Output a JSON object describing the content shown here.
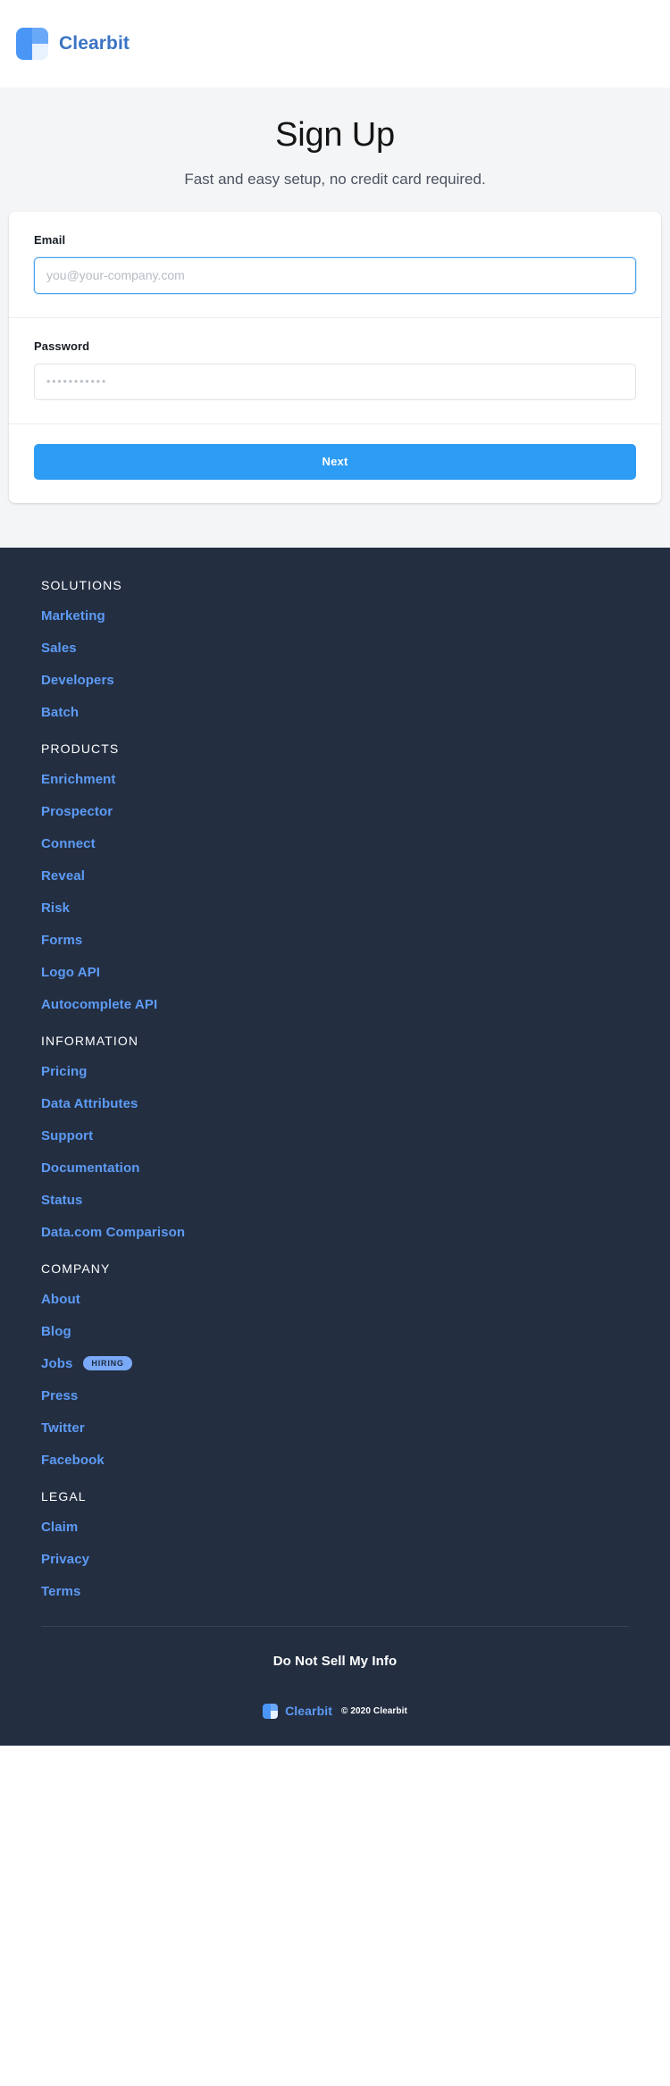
{
  "header": {
    "logo_icon": "clearbit-logo-icon",
    "brand_name": "Clearbit"
  },
  "hero": {
    "title": "Sign Up",
    "subtitle": "Fast and easy setup, no credit card required."
  },
  "form": {
    "email": {
      "label": "Email",
      "value": "",
      "placeholder": "you@your-company.com",
      "focused": true
    },
    "password": {
      "label": "Password",
      "value": "",
      "placeholder": "•••••••••••",
      "focused": false
    },
    "submit_label": "Next"
  },
  "footer": {
    "groups": [
      {
        "heading": "SOLUTIONS",
        "links": [
          {
            "label": "Marketing"
          },
          {
            "label": "Sales"
          },
          {
            "label": "Developers"
          },
          {
            "label": "Batch"
          }
        ]
      },
      {
        "heading": "PRODUCTS",
        "links": [
          {
            "label": "Enrichment"
          },
          {
            "label": "Prospector"
          },
          {
            "label": "Connect"
          },
          {
            "label": "Reveal"
          },
          {
            "label": "Risk"
          },
          {
            "label": "Forms"
          },
          {
            "label": "Logo API"
          },
          {
            "label": "Autocomplete API"
          }
        ]
      },
      {
        "heading": "INFORMATION",
        "links": [
          {
            "label": "Pricing"
          },
          {
            "label": "Data Attributes"
          },
          {
            "label": "Support"
          },
          {
            "label": "Documentation"
          },
          {
            "label": "Status"
          },
          {
            "label": "Data.com Comparison"
          }
        ]
      },
      {
        "heading": "COMPANY",
        "links": [
          {
            "label": "About"
          },
          {
            "label": "Blog"
          },
          {
            "label": "Jobs",
            "badge": "HIRING"
          },
          {
            "label": "Press"
          },
          {
            "label": "Twitter"
          },
          {
            "label": "Facebook"
          }
        ]
      },
      {
        "heading": "LEGAL",
        "links": [
          {
            "label": "Claim"
          },
          {
            "label": "Privacy"
          },
          {
            "label": "Terms"
          }
        ]
      }
    ],
    "do_not_sell": "Do Not Sell My Info",
    "brand_name": "Clearbit",
    "copyright": "© 2020 Clearbit",
    "logo_icon": "clearbit-logo-icon"
  },
  "colors": {
    "brand_blue": "#3b74c4",
    "link_blue": "#5d9bf5",
    "button_blue": "#2d9cf5",
    "footer_bg": "#232e41",
    "hero_bg": "#f4f5f7",
    "badge_bg": "#7aa9f7",
    "focus_border": "#4aa3f0"
  }
}
